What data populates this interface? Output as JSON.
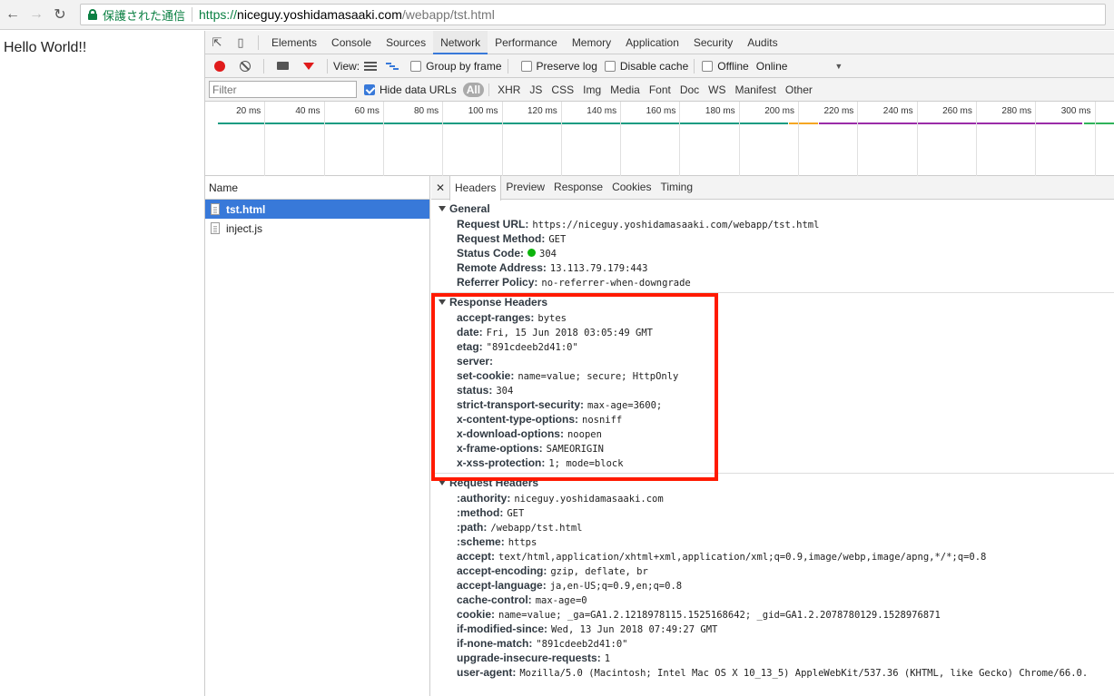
{
  "browser": {
    "back_icon": "arrow-left-icon",
    "forward_icon": "arrow-right-icon",
    "reload_icon": "reload-icon",
    "secure_label": "保護された通信",
    "url_scheme": "https://",
    "url_host": "niceguy.yoshidamasaaki.com",
    "url_path": "/webapp/tst.html"
  },
  "page": {
    "text": "Hello World!!"
  },
  "devtools": {
    "tabs": [
      "Elements",
      "Console",
      "Sources",
      "Network",
      "Performance",
      "Memory",
      "Application",
      "Security",
      "Audits"
    ],
    "active_tab": "Network",
    "toolbar": {
      "view_label": "View:",
      "group_by_frame": "Group by frame",
      "preserve_log": "Preserve log",
      "disable_cache": "Disable cache",
      "offline": "Offline",
      "throttle": "Online"
    },
    "filterbar": {
      "placeholder": "Filter",
      "hide_data_urls": "Hide data URLs",
      "types": [
        "All",
        "XHR",
        "JS",
        "CSS",
        "Img",
        "Media",
        "Font",
        "Doc",
        "WS",
        "Manifest",
        "Other"
      ]
    },
    "timeline_ticks": [
      "20 ms",
      "40 ms",
      "60 ms",
      "80 ms",
      "100 ms",
      "120 ms",
      "140 ms",
      "160 ms",
      "180 ms",
      "200 ms",
      "220 ms",
      "240 ms",
      "260 ms",
      "280 ms",
      "300 ms"
    ],
    "request_list": {
      "header": "Name",
      "items": [
        "tst.html",
        "inject.js"
      ]
    },
    "detail_tabs": [
      "Headers",
      "Preview",
      "Response",
      "Cookies",
      "Timing"
    ],
    "general": {
      "title": "General",
      "rows": [
        {
          "k": "Request URL:",
          "v": "https://niceguy.yoshidamasaaki.com/webapp/tst.html"
        },
        {
          "k": "Request Method:",
          "v": "GET"
        },
        {
          "k": "Status Code:",
          "v": "304"
        },
        {
          "k": "Remote Address:",
          "v": "13.113.79.179:443"
        },
        {
          "k": "Referrer Policy:",
          "v": "no-referrer-when-downgrade"
        }
      ]
    },
    "response_headers": {
      "title": "Response Headers",
      "rows": [
        {
          "k": "accept-ranges:",
          "v": "bytes"
        },
        {
          "k": "date:",
          "v": "Fri, 15 Jun 2018 03:05:49 GMT"
        },
        {
          "k": "etag:",
          "v": "\"891cdeeb2d41:0\""
        },
        {
          "k": "server:",
          "v": ""
        },
        {
          "k": "set-cookie:",
          "v": "name=value; secure; HttpOnly"
        },
        {
          "k": "status:",
          "v": "304"
        },
        {
          "k": "strict-transport-security:",
          "v": "max-age=3600;"
        },
        {
          "k": "x-content-type-options:",
          "v": "nosniff"
        },
        {
          "k": "x-download-options:",
          "v": "noopen"
        },
        {
          "k": "x-frame-options:",
          "v": "SAMEORIGIN"
        },
        {
          "k": "x-xss-protection:",
          "v": "1; mode=block"
        }
      ]
    },
    "request_headers": {
      "title": "Request Headers",
      "rows": [
        {
          "k": ":authority:",
          "v": "niceguy.yoshidamasaaki.com"
        },
        {
          "k": ":method:",
          "v": "GET"
        },
        {
          "k": ":path:",
          "v": "/webapp/tst.html"
        },
        {
          "k": ":scheme:",
          "v": "https"
        },
        {
          "k": "accept:",
          "v": "text/html,application/xhtml+xml,application/xml;q=0.9,image/webp,image/apng,*/*;q=0.8"
        },
        {
          "k": "accept-encoding:",
          "v": "gzip, deflate, br"
        },
        {
          "k": "accept-language:",
          "v": "ja,en-US;q=0.9,en;q=0.8"
        },
        {
          "k": "cache-control:",
          "v": "max-age=0"
        },
        {
          "k": "cookie:",
          "v": "name=value; _ga=GA1.2.1218978115.1525168642; _gid=GA1.2.2078780129.1528976871"
        },
        {
          "k": "if-modified-since:",
          "v": "Wed, 13 Jun 2018 07:49:27 GMT"
        },
        {
          "k": "if-none-match:",
          "v": "\"891cdeeb2d41:0\""
        },
        {
          "k": "upgrade-insecure-requests:",
          "v": "1"
        },
        {
          "k": "user-agent:",
          "v": "Mozilla/5.0 (Macintosh; Intel Mac OS X 10_13_5) AppleWebKit/537.36 (KHTML, like Gecko) Chrome/66.0."
        }
      ]
    },
    "colors": {
      "accent": "#3879d9",
      "record": "#e01b1b",
      "secure": "#0b8043",
      "highlight": "#ff1a00",
      "status_ok": "#0cb30c"
    }
  }
}
